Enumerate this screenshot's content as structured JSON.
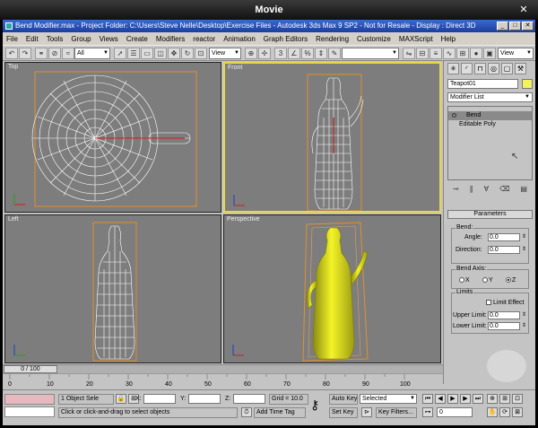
{
  "outer_window": {
    "title": "Movie",
    "close_label": "✕"
  },
  "app": {
    "title": "Bend Modifier.max   - Project Folder: C:\\Users\\Steve Nelle\\Desktop\\Exercise Files    - Autodesk 3ds Max 9 SP2  - Not for Resale   - Display : Direct 3D",
    "window_buttons": [
      "_",
      "□",
      "✕"
    ]
  },
  "menu": [
    "File",
    "Edit",
    "Tools",
    "Group",
    "Views",
    "Create",
    "Modifiers",
    "reactor",
    "Animation",
    "Graph Editors",
    "Rendering",
    "Customize",
    "MAXScript",
    "Help"
  ],
  "toolbar": {
    "selection_filter": "All",
    "ref_coord": "View",
    "right_view": "View"
  },
  "viewports": {
    "top": "Top",
    "front": "Front",
    "left": "Left",
    "perspective": "Perspective"
  },
  "command_panel": {
    "object_name": "Teapot01",
    "object_color": "#f2f25a",
    "modifier_list": "Modifier List",
    "stack": [
      "Bend",
      "Editable Poly"
    ],
    "rollout_title": "Parameters",
    "bend_group": "Bend:",
    "angle_label": "Angle:",
    "angle_value": "0.0",
    "direction_label": "Direction:",
    "direction_value": "0.0",
    "axis_group": "Bend Axis:",
    "axis_x": "X",
    "axis_y": "Y",
    "axis_z": "Z",
    "limits_group": "Limits",
    "limit_effect": "Limit Effect",
    "upper_label": "Upper Limit:",
    "upper_value": "0.0",
    "lower_label": "Lower Limit:",
    "lower_value": "0.0"
  },
  "timeline": {
    "frame_display": "0 / 100",
    "ticks": [
      "0",
      "10",
      "20",
      "30",
      "40",
      "50",
      "60",
      "70",
      "80",
      "90",
      "100"
    ]
  },
  "status": {
    "selection": "1 Object Sele",
    "x_label": "X:",
    "y_label": "Y:",
    "z_label": "Z:",
    "grid": "Grid = 10.0",
    "auto_key": "Auto Key",
    "key_mode": "Selected",
    "set_key": "Set Key",
    "key_filters": "Key Filters...",
    "prompt": "Click or click-and-drag to select objects",
    "add_time_tag": "Add Time Tag",
    "current_frame": "0"
  }
}
